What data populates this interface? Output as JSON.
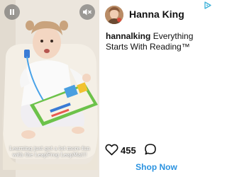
{
  "brand": {
    "name": "Hanna King",
    "accent_color": "#2b93e0",
    "adchoices_icon": "adchoices-icon"
  },
  "video": {
    "caption": "Learning just got a lot more fun with the LeapFrog LeapMat!!",
    "pause_icon": "pause-icon",
    "mute_icon": "muted-speaker-icon"
  },
  "post": {
    "handle": "hannalking",
    "text": "Everything Starts With Reading™"
  },
  "engagement": {
    "likes": "455",
    "like_icon": "heart-icon",
    "comment_icon": "comment-icon"
  },
  "cta": {
    "label": "Shop Now"
  }
}
